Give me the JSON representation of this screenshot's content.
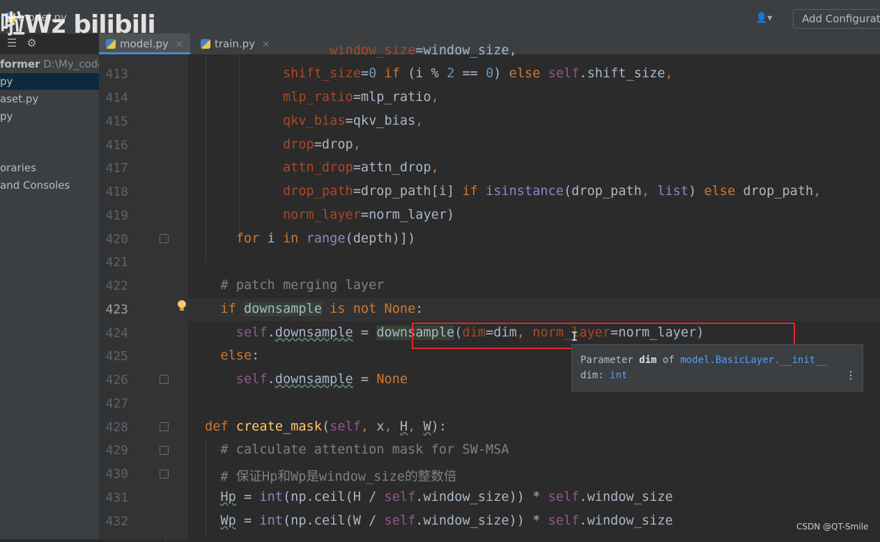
{
  "window": {
    "crumb": "model.py",
    "watermark": "啦Wz bilibili",
    "add_config": "Add Configurati"
  },
  "tabs": [
    {
      "label": "model.py",
      "active": true
    },
    {
      "label": "train.py",
      "active": false
    }
  ],
  "project": {
    "root_name": "former",
    "root_path": "D:\\My_code",
    "items": [
      {
        "label": "py",
        "selected": true
      },
      {
        "label": "aset.py",
        "selected": false
      },
      {
        "label": "py",
        "selected": false
      },
      {
        "label": "oraries",
        "selected": false
      },
      {
        "label": "and Consoles",
        "selected": false
      }
    ]
  },
  "line_numbers": [
    "413",
    "414",
    "415",
    "416",
    "417",
    "418",
    "419",
    "420",
    "421",
    "422",
    "423",
    "424",
    "425",
    "426",
    "427",
    "428",
    "429",
    "430",
    "431",
    "432"
  ],
  "current_line": "423",
  "tooltip": {
    "prefix": "Parameter",
    "param": "dim",
    "of": "of",
    "target": "model.BasicLayer.__init__",
    "type_label": "dim:",
    "type": "int"
  },
  "footer": {
    "csdn": "CSDN @QT-Smile"
  },
  "colors": {
    "keyword": "#cc7832",
    "number": "#6897bb",
    "self": "#94558d",
    "param": "#aa4926",
    "func": "#ffc66d",
    "builtin": "#8888c6",
    "comment": "#808080",
    "highlight_box": "#e0282c"
  }
}
